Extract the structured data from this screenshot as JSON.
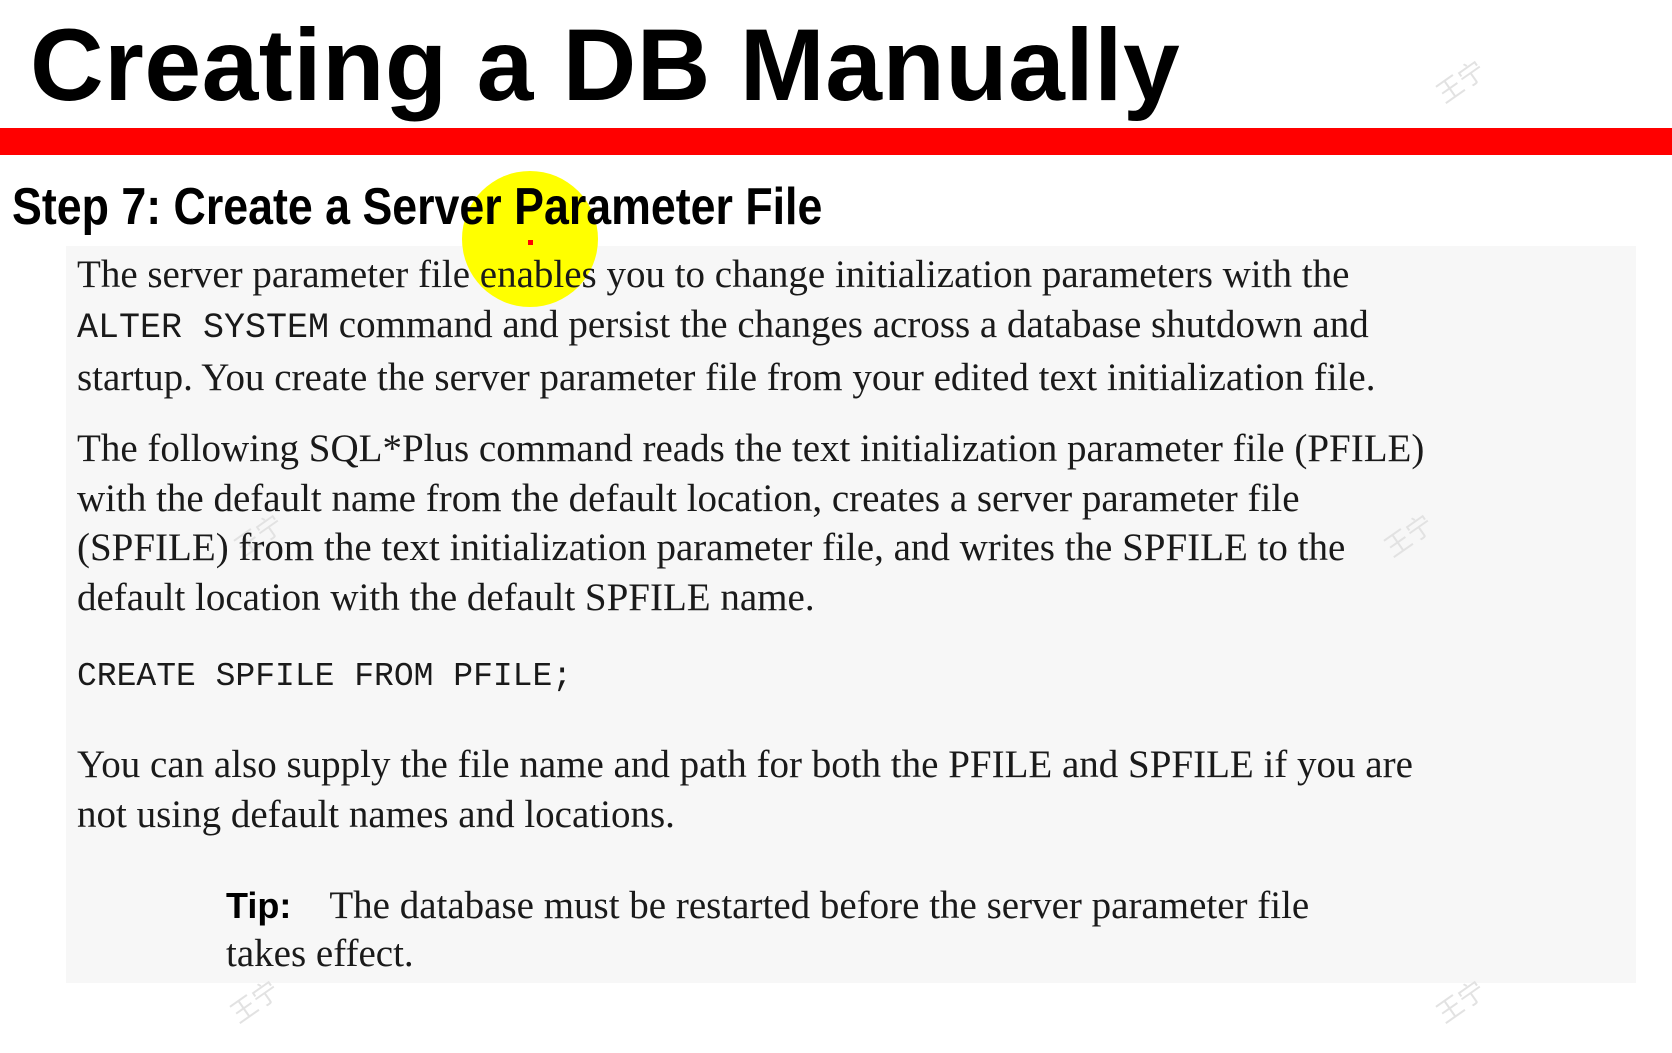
{
  "slide": {
    "title": "Creating a DB Manually",
    "colors": {
      "rule": "#ff0000",
      "highlight": "#ffff00",
      "panel": "#f7f7f7"
    }
  },
  "document": {
    "heading": "Step 7: Create a Server Parameter File",
    "para1": {
      "line1": "The server parameter file enables you to change initialization parameters with the",
      "line2_code": "ALTER SYSTEM",
      "line2_text": " command and persist the changes across a database shutdown and",
      "line3": "startup. You create the server parameter file from your edited text initialization file."
    },
    "para2": {
      "line1": "The following SQL*Plus command reads the text initialization parameter file (PFILE)",
      "line2": "with the default name from the default location, creates a server parameter file",
      "line3": "(SPFILE) from the text initialization parameter file, and writes the SPFILE to the",
      "line4": "default location with the default SPFILE name."
    },
    "code": "CREATE SPFILE FROM PFILE;",
    "para3": {
      "line1": "You can also supply the file name and path for both the PFILE and SPFILE if you are",
      "line2": "not using default names and locations."
    },
    "tip": {
      "label": "Tip:",
      "line1": "The database must be restarted before the server parameter file",
      "line2": "takes effect."
    }
  },
  "watermark": {
    "text": "王宁"
  }
}
